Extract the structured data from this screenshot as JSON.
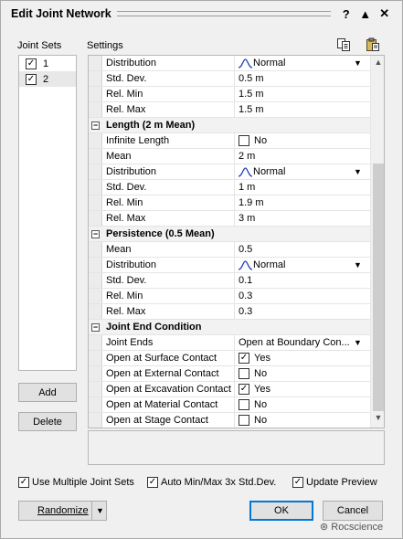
{
  "window": {
    "title": "Edit Joint Network",
    "help_glyph": "?",
    "collapse_glyph": "▲",
    "close_glyph": "✕"
  },
  "labels": {
    "joint_sets": "Joint Sets",
    "settings": "Settings"
  },
  "joint_sets": [
    {
      "label": "1",
      "checked": true
    },
    {
      "label": "2",
      "checked": true
    }
  ],
  "buttons": {
    "add": "Add",
    "delete": "Delete",
    "randomize": "Randomize",
    "ok": "OK",
    "cancel": "Cancel"
  },
  "settings_rows": [
    {
      "type": "prop",
      "name": "Distribution",
      "value": "Normal",
      "curve": true,
      "dropdown": true
    },
    {
      "type": "prop",
      "name": "Std. Dev.",
      "value": "0.5 m"
    },
    {
      "type": "prop",
      "name": "Rel. Min",
      "value": "1.5 m"
    },
    {
      "type": "prop",
      "name": "Rel. Max",
      "value": "1.5 m"
    },
    {
      "type": "section",
      "name": "Length  (2 m  Mean)"
    },
    {
      "type": "prop",
      "name": "Infinite Length",
      "value": "No",
      "checkbox": true,
      "checked": false
    },
    {
      "type": "prop",
      "name": "Mean",
      "value": "2 m"
    },
    {
      "type": "prop",
      "name": "Distribution",
      "value": "Normal",
      "curve": true,
      "dropdown": true
    },
    {
      "type": "prop",
      "name": "Std. Dev.",
      "value": "1 m"
    },
    {
      "type": "prop",
      "name": "Rel. Min",
      "value": "1.9 m"
    },
    {
      "type": "prop",
      "name": "Rel. Max",
      "value": "3 m"
    },
    {
      "type": "section",
      "name": "Persistence  (0.5  Mean)"
    },
    {
      "type": "prop",
      "name": "Mean",
      "value": "0.5"
    },
    {
      "type": "prop",
      "name": "Distribution",
      "value": "Normal",
      "curve": true,
      "dropdown": true
    },
    {
      "type": "prop",
      "name": "Std. Dev.",
      "value": "0.1"
    },
    {
      "type": "prop",
      "name": "Rel. Min",
      "value": "0.3"
    },
    {
      "type": "prop",
      "name": "Rel. Max",
      "value": "0.3"
    },
    {
      "type": "section",
      "name": "Joint End Condition"
    },
    {
      "type": "prop",
      "name": "Joint Ends",
      "value": "Open at Boundary Con...",
      "dropdown": true
    },
    {
      "type": "prop",
      "name": "Open at Surface Contact",
      "value": "Yes",
      "checkbox": true,
      "checked": true
    },
    {
      "type": "prop",
      "name": "Open at External Contact",
      "value": "No",
      "checkbox": true,
      "checked": false
    },
    {
      "type": "prop",
      "name": "Open at Excavation Contact",
      "value": "Yes",
      "checkbox": true,
      "checked": true
    },
    {
      "type": "prop",
      "name": "Open at Material Contact",
      "value": "No",
      "checkbox": true,
      "checked": false
    },
    {
      "type": "prop",
      "name": "Open at Stage Contact",
      "value": "No",
      "checkbox": true,
      "checked": false
    }
  ],
  "options": [
    {
      "label": "Use Multiple Joint Sets",
      "checked": true
    },
    {
      "label": "Auto Min/Max 3x Std.Dev.",
      "checked": true
    },
    {
      "label": "Update Preview",
      "checked": true
    }
  ],
  "watermark": "Rocscience",
  "icons": {
    "copy": "copy-icon",
    "paste": "paste-icon",
    "dropdown": "chevron-down-icon",
    "curve": "normal-curve-icon"
  },
  "colors": {
    "ok_border": "#0078d7",
    "background": "#f0f0f0",
    "curve": "#1a3fb4"
  }
}
